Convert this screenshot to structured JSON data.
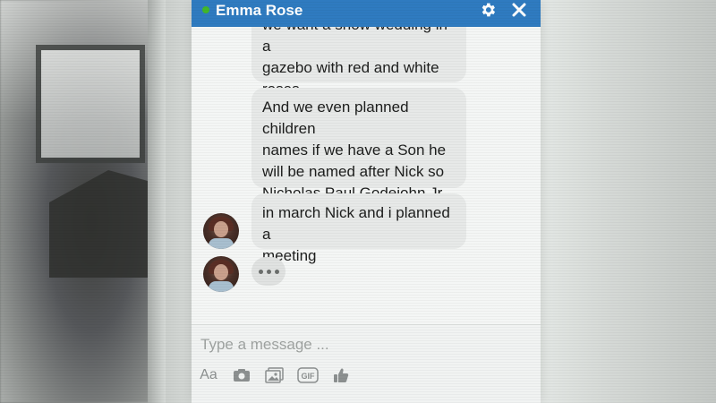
{
  "chat": {
    "contact_name": "Emma Rose",
    "online": true,
    "colors": {
      "header": "#2f7bc0",
      "online_dot": "#42b72a",
      "bubble": "#e7e9e8"
    },
    "messages": [
      {
        "lines": [
          "we want a snow wedding in a",
          "gazebo with red and white",
          "roses."
        ]
      },
      {
        "lines": [
          "And we even planned children",
          "names if we have a Son he",
          "will be named after Nick so",
          "Nicholas Paul Godejohn Jr."
        ]
      },
      {
        "lines": [
          "in march Nick and i planned a",
          "meeting"
        ]
      }
    ],
    "typing_indicator": "•••"
  },
  "composer": {
    "placeholder": "Type a message ...",
    "value": "",
    "tools": [
      {
        "name": "text-format",
        "label": "Aa"
      },
      {
        "name": "camera-icon"
      },
      {
        "name": "image-icon"
      },
      {
        "name": "gif-icon",
        "label": "GIF"
      },
      {
        "name": "thumbs-up-icon"
      }
    ]
  },
  "header_icons": [
    "gear-icon",
    "close-icon"
  ]
}
